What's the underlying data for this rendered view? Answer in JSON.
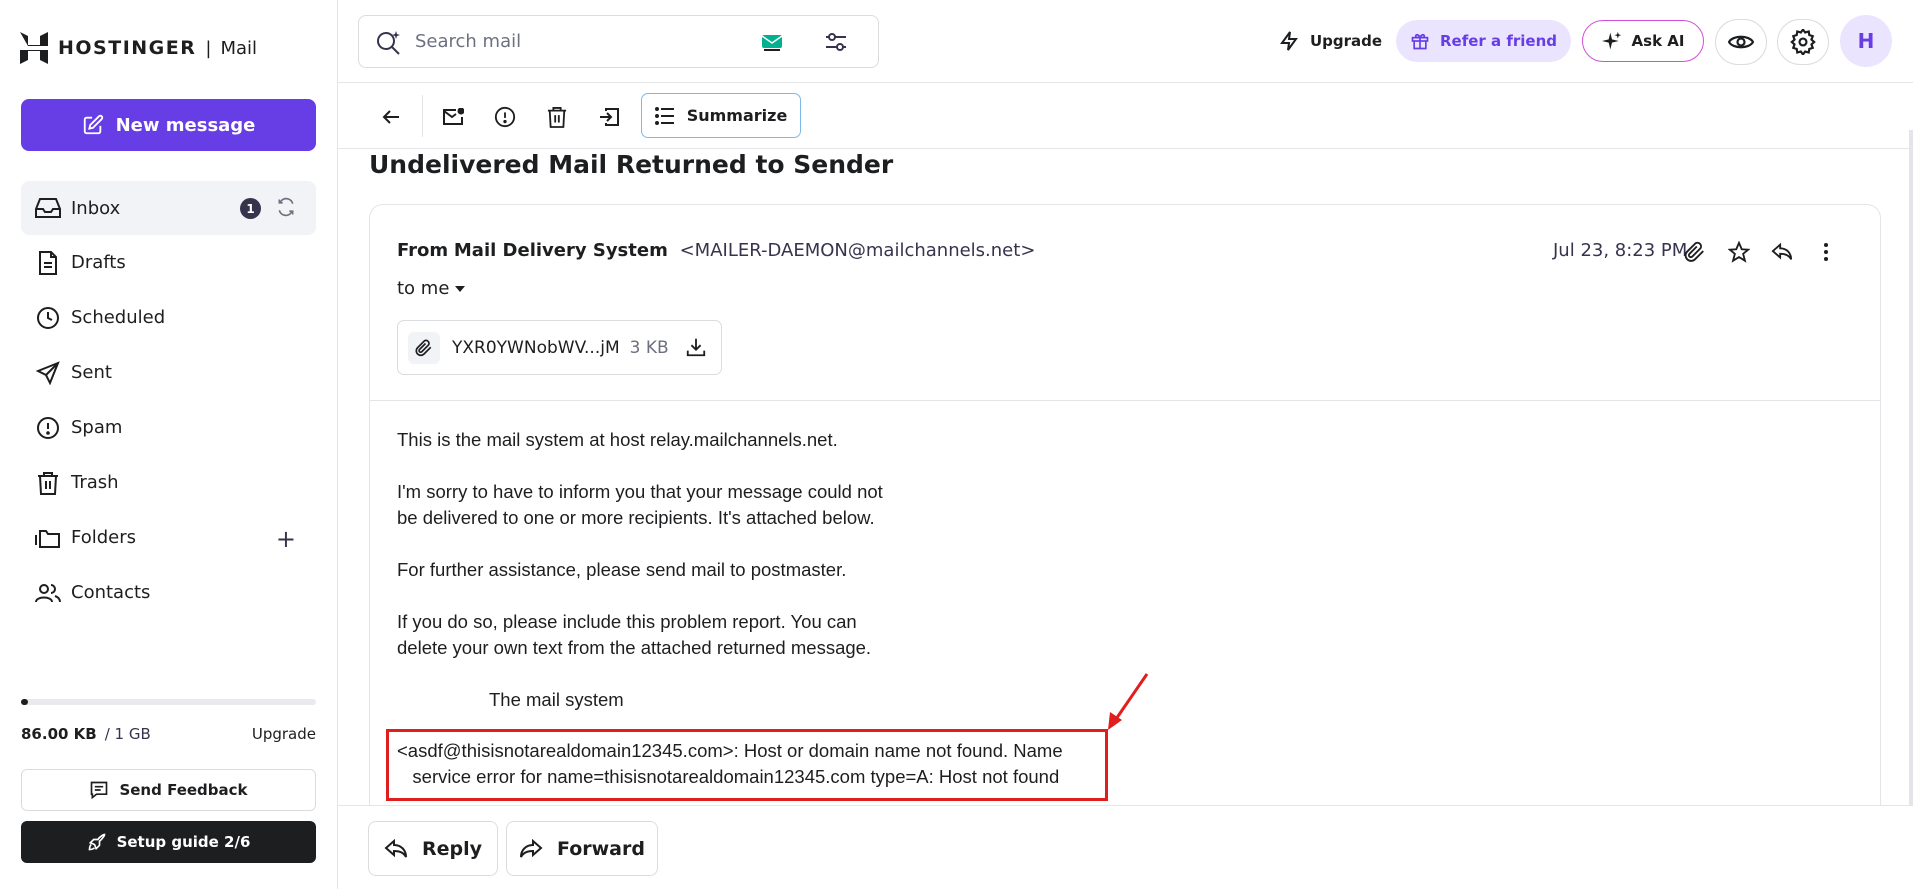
{
  "brand": {
    "name": "HOSTINGER",
    "product": "Mail",
    "separator": "|"
  },
  "sidebar": {
    "new_message": "New message",
    "items": [
      {
        "label": "Inbox",
        "icon": "inbox-icon",
        "badge": "1"
      },
      {
        "label": "Drafts",
        "icon": "drafts-icon"
      },
      {
        "label": "Scheduled",
        "icon": "clock-icon"
      },
      {
        "label": "Sent",
        "icon": "send-icon"
      },
      {
        "label": "Spam",
        "icon": "spam-icon"
      },
      {
        "label": "Trash",
        "icon": "trash-icon"
      },
      {
        "label": "Folders",
        "icon": "folders-icon"
      },
      {
        "label": "Contacts",
        "icon": "contacts-icon"
      }
    ],
    "storage": {
      "used": "86.00 KB",
      "total": "/ 1 GB",
      "upgrade": "Upgrade",
      "fraction": 0.0001
    },
    "send_feedback": "Send Feedback",
    "setup_guide": "Setup guide 2/6"
  },
  "topbar": {
    "search_placeholder": "Search mail",
    "upgrade": "Upgrade",
    "refer": "Refer a friend",
    "ask_ai": "Ask AI",
    "avatar_initial": "H"
  },
  "toolbar": {
    "summarize": "Summarize"
  },
  "email": {
    "subject": "Undelivered Mail Returned to Sender",
    "from_prefix": "From",
    "from_name": "Mail Delivery System",
    "from_address": "<MAILER-DAEMON@mailchannels.net>",
    "to": "to me",
    "date": "Jul 23, 8:23 PM",
    "attachment": {
      "name": "YXR0YWNobWV...jM",
      "size": "3 KB"
    },
    "body": [
      "This is the mail system at host relay.mailchannels.net.",
      "I'm sorry to have to inform you that your message could not\nbe delivered to one or more recipients. It's attached below.",
      "For further assistance, please send mail to postmaster.",
      "If you do so, please include this problem report. You can\ndelete your own text from the attached returned message.",
      "The mail system"
    ],
    "error": "<asdf@thisisnotarealdomain12345.com>: Host or domain name not found. Name\n   service error for name=thisisnotarealdomain12345.com type=A: Host not found"
  },
  "actions": {
    "reply": "Reply",
    "forward": "Forward"
  },
  "colors": {
    "accent": "#673de6",
    "highlight": "#e01e1e",
    "dark": "#1d1e20"
  }
}
